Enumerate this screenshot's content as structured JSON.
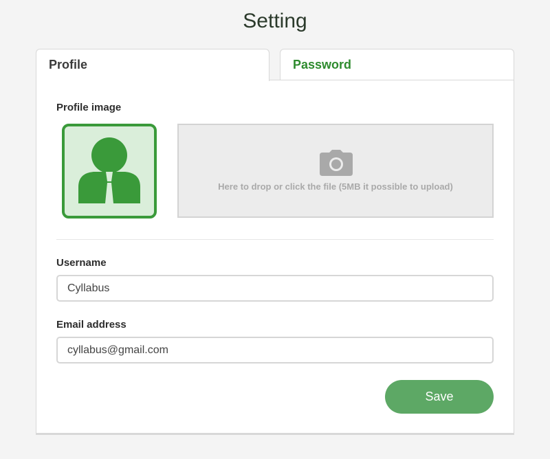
{
  "page": {
    "title": "Setting"
  },
  "tabs": [
    {
      "label": "Profile",
      "active": true
    },
    {
      "label": "Password",
      "active": false
    }
  ],
  "profile_image": {
    "label": "Profile image",
    "avatar_icon": "user-avatar-icon",
    "dropzone_icon": "camera-icon",
    "dropzone_text": "Here to drop or click the file (5MB it possible to upload)"
  },
  "username": {
    "label": "Username",
    "value": "Cyllabus"
  },
  "email": {
    "label": "Email address",
    "value": "cyllabus@gmail.com"
  },
  "save_label": "Save",
  "colors": {
    "accent": "#2e8b2e",
    "button": "#5da865",
    "avatar_border": "#3a9a3a",
    "avatar_bg": "#daeeda"
  }
}
